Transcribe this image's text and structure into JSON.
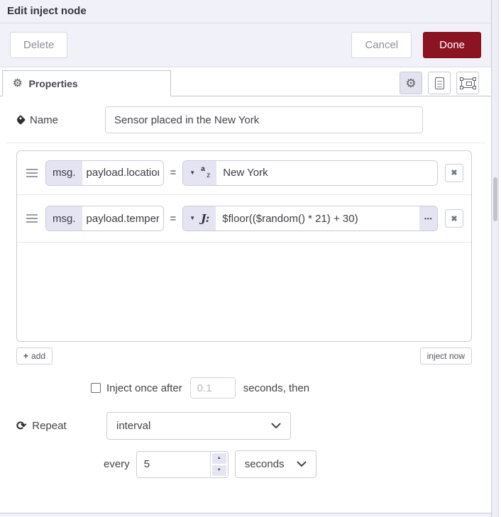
{
  "header": {
    "title": "Edit inject node"
  },
  "toolbar": {
    "delete": "Delete",
    "cancel": "Cancel",
    "done": "Done"
  },
  "tab": {
    "properties": "Properties"
  },
  "form": {
    "name_label": "Name",
    "name_value": "Sensor placed in the New York",
    "props": [
      {
        "prefix": "msg.",
        "key": "payload.location",
        "op": "=",
        "type": "string",
        "value": "New York"
      },
      {
        "prefix": "msg.",
        "key": "payload.temperature",
        "op": "=",
        "type": "jsonata",
        "value": "$floor(($random() * 21) + 30)"
      }
    ],
    "add": "add",
    "inject_now": "inject now",
    "once_label": "Inject once after",
    "once_value": "0.1",
    "once_suffix": "seconds, then",
    "repeat_label": "Repeat",
    "repeat_value": "interval",
    "every_label": "every",
    "every_value": "5",
    "every_unit": "seconds"
  },
  "icons": {
    "close": "✖",
    "caret_down": "▼",
    "plus": "+",
    "repeat": "⟳",
    "spinner_up": "▲",
    "spinner_down": "▼",
    "expand": "•••",
    "gear": "⚙",
    "az_a": "a",
    "az_z": "z",
    "jsonata": "J:"
  },
  "colors": {
    "done_button": "#8C1321",
    "accent_lavender": "#e4e4f2",
    "panel_bg": "#f1f1f9"
  }
}
